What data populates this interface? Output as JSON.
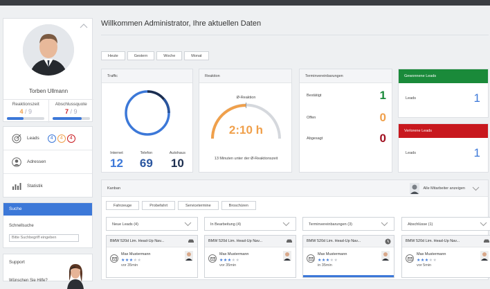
{
  "profile": {
    "name": "Torben Ullmann",
    "kpis": [
      {
        "label": "Reaktionszeit",
        "value": "4",
        "total": "/ 9",
        "color": "#f0a04b",
        "fraction": 0.44
      },
      {
        "label": "Abschlussquote",
        "value": "7",
        "total": "/ 9",
        "color": "#c8181e",
        "fraction": 0.78
      }
    ]
  },
  "nav": {
    "items": [
      {
        "label": "Leads",
        "icon": "target-icon"
      },
      {
        "label": "Adressen",
        "icon": "person-icon"
      },
      {
        "label": "Statistik",
        "icon": "bar-chart-icon"
      }
    ],
    "lead_badges": [
      {
        "value": "4",
        "color": "#3c78d8"
      },
      {
        "value": "4",
        "color": "#f0a04b"
      },
      {
        "value": "4",
        "color": "#c8181e"
      }
    ]
  },
  "search": {
    "title": "Suche",
    "label": "Schnellsuche",
    "placeholder": "Bitte Suchbegriff eingeben"
  },
  "support": {
    "title": "Support",
    "question": "Wünschen Sie Hilfe?"
  },
  "main": {
    "title": "Willkommen Administrator, Ihre aktuellen Daten",
    "periods": [
      "Heute",
      "Gestern",
      "Woche",
      "Monat"
    ]
  },
  "traffic": {
    "title": "Traffic",
    "stats": [
      {
        "label": "Internet",
        "value": "12",
        "color": "#3c78d8"
      },
      {
        "label": "Telefon",
        "value": "69",
        "color": "#2a56a0"
      },
      {
        "label": "Autohaus",
        "value": "10",
        "color": "#1c2e4f"
      }
    ]
  },
  "reaktion": {
    "title": "Reaktion",
    "label": "Ø-Reaktion",
    "time": "2:10 h",
    "footer": "13 Minuten unter der Ø-Reaktionszeit"
  },
  "termine": {
    "title": "Terminvereinbarungen",
    "rows": [
      {
        "label": "Bestätigt",
        "value": "1",
        "color": "#1a8a3a"
      },
      {
        "label": "Offen",
        "value": "0",
        "color": "#f0a04b"
      },
      {
        "label": "Abgesagt",
        "value": "0",
        "color": "#a01020"
      }
    ]
  },
  "won": {
    "title": "Gewonnene Leads",
    "label": "Leads",
    "value": "1"
  },
  "lost": {
    "title": "Verlorene Leads",
    "label": "Leads",
    "value": "1"
  },
  "kanban": {
    "title": "Kanban",
    "all_label": "Alle Mitarbeiter anzeigen",
    "filters": [
      "Fahrzeuge",
      "Probefahrt",
      "Servicetermine",
      "Broschüren"
    ],
    "columns": [
      {
        "title": "Neue Leads (4)",
        "car": "BMW 520d Lim. Head-Up Nav...",
        "name": "Max Mustermann",
        "time": "vor 35min",
        "stars": 3
      },
      {
        "title": "In Bearbeitung (4)",
        "car": "BMW 520d Lim. Head-Up Nav...",
        "name": "Max Mustermann",
        "time": "vor 35min",
        "stars": 3
      },
      {
        "title": "Terminvereinbarungen (3)",
        "car": "BMW 520d Lim. Head-Up Nav...",
        "name": "Max Mustermann",
        "time": "in 35min",
        "stars": 3
      },
      {
        "title": "Abschlüsse (1)",
        "car": "BMW 520d Lim. Head-Up Nav...",
        "name": "Max Mustermann",
        "time": "vor 5min",
        "stars": 3
      }
    ]
  }
}
